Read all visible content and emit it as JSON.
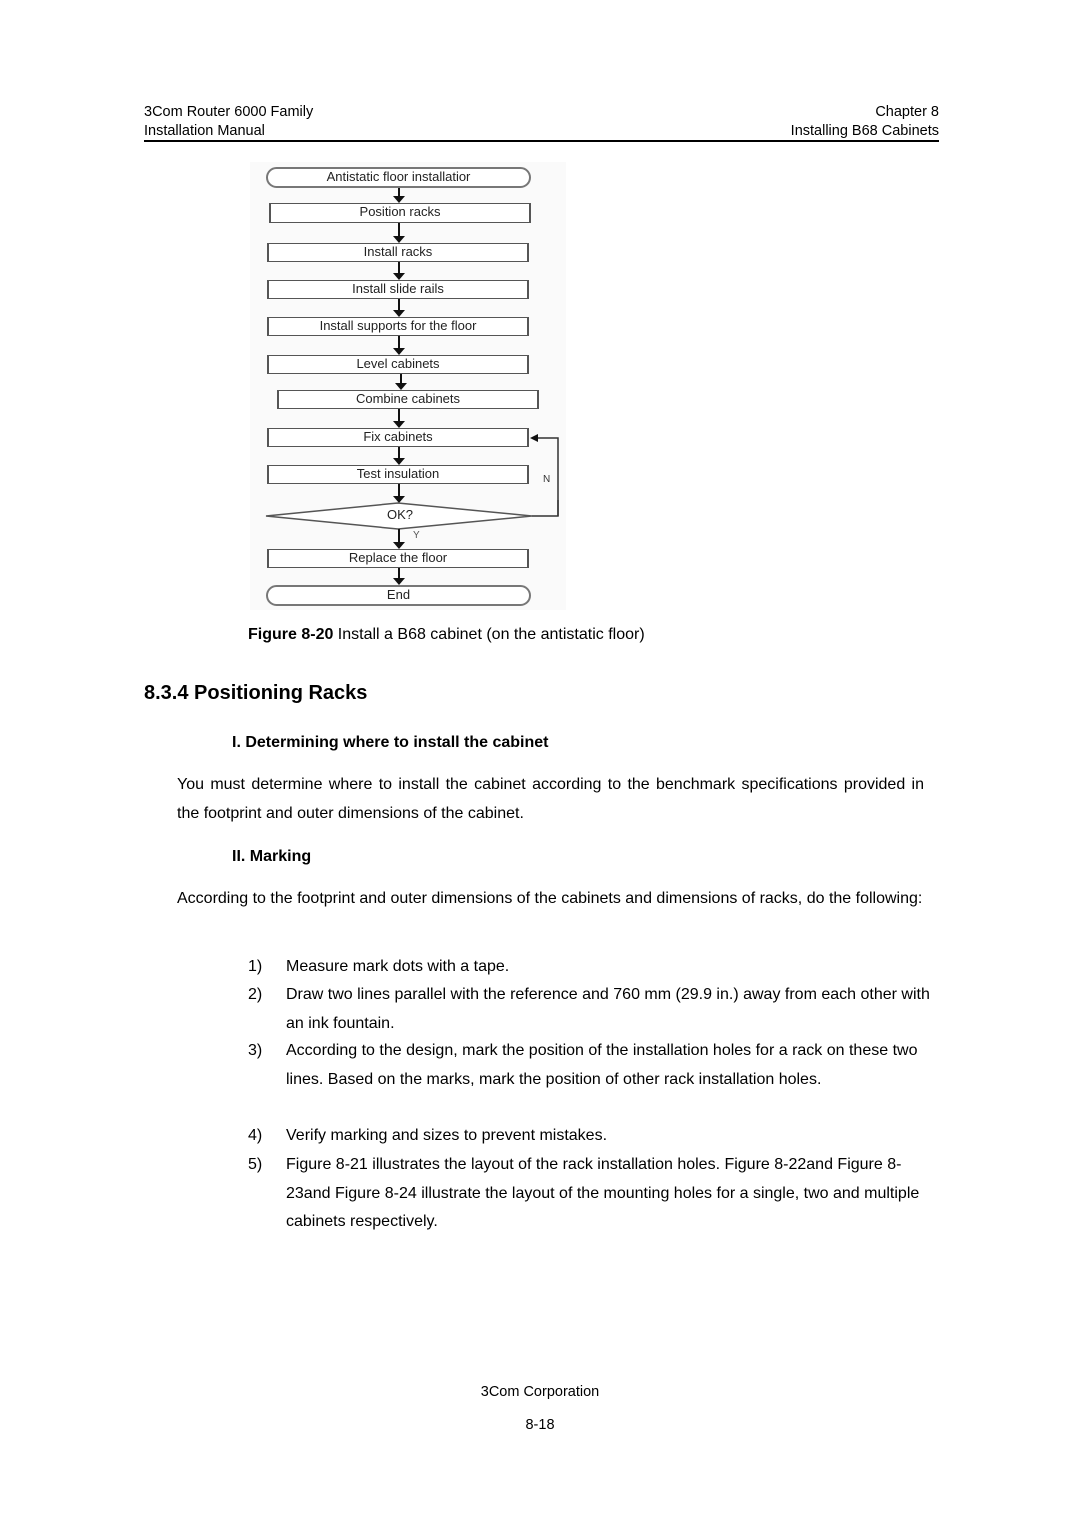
{
  "header": {
    "left_line1": "3Com Router 6000 Family",
    "left_line2": "Installation Manual",
    "right_line1": "Chapter 8",
    "right_line2": "Installing B68 Cabinets"
  },
  "flowchart": {
    "start": "Antistatic floor installatior",
    "steps": [
      "Position racks",
      "Install racks",
      "Install slide rails",
      "Install supports for the floor",
      "Level cabinets",
      "Combine cabinets",
      "Fix cabinets",
      "Test insulation"
    ],
    "decision": "OK?",
    "yes_label": "Y",
    "no_label": "N",
    "after": "Replace the floor",
    "end": "End"
  },
  "figure_caption": {
    "label": "Figure 8-20",
    "text": " Install a B68 cabinet (on the antistatic floor)"
  },
  "section": {
    "title": "8.3.4  Positioning Racks"
  },
  "sub1": {
    "title": "I. Determining where to install the cabinet",
    "body": "You must determine where to install the cabinet according to the benchmark specifications provided in the footprint and outer dimensions of the cabinet."
  },
  "sub2": {
    "title": "II. Marking",
    "body": "According to the footprint and outer dimensions of the cabinets and dimensions of racks, do the following:",
    "items": [
      {
        "n": "1)",
        "t": "Measure mark dots with a tape."
      },
      {
        "n": "2)",
        "t": "Draw two lines parallel with the reference and 760 mm (29.9 in.) away from each other with an ink fountain."
      },
      {
        "n": "3)",
        "t": "According to the design, mark the position of the installation holes for a rack on these two lines. Based on the marks, mark the position of other rack installation holes."
      },
      {
        "n": "4)",
        "t": "Verify marking and sizes to prevent mistakes."
      },
      {
        "n": "5)",
        "t": "Figure 8-21 illustrates the layout of the rack installation holes. Figure 8-22and Figure 8-23and Figure 8-24 illustrate the layout of the mounting holes for a single, two and multiple cabinets respectively."
      }
    ]
  },
  "footer": {
    "company": "3Com Corporation",
    "page": "8-18"
  }
}
